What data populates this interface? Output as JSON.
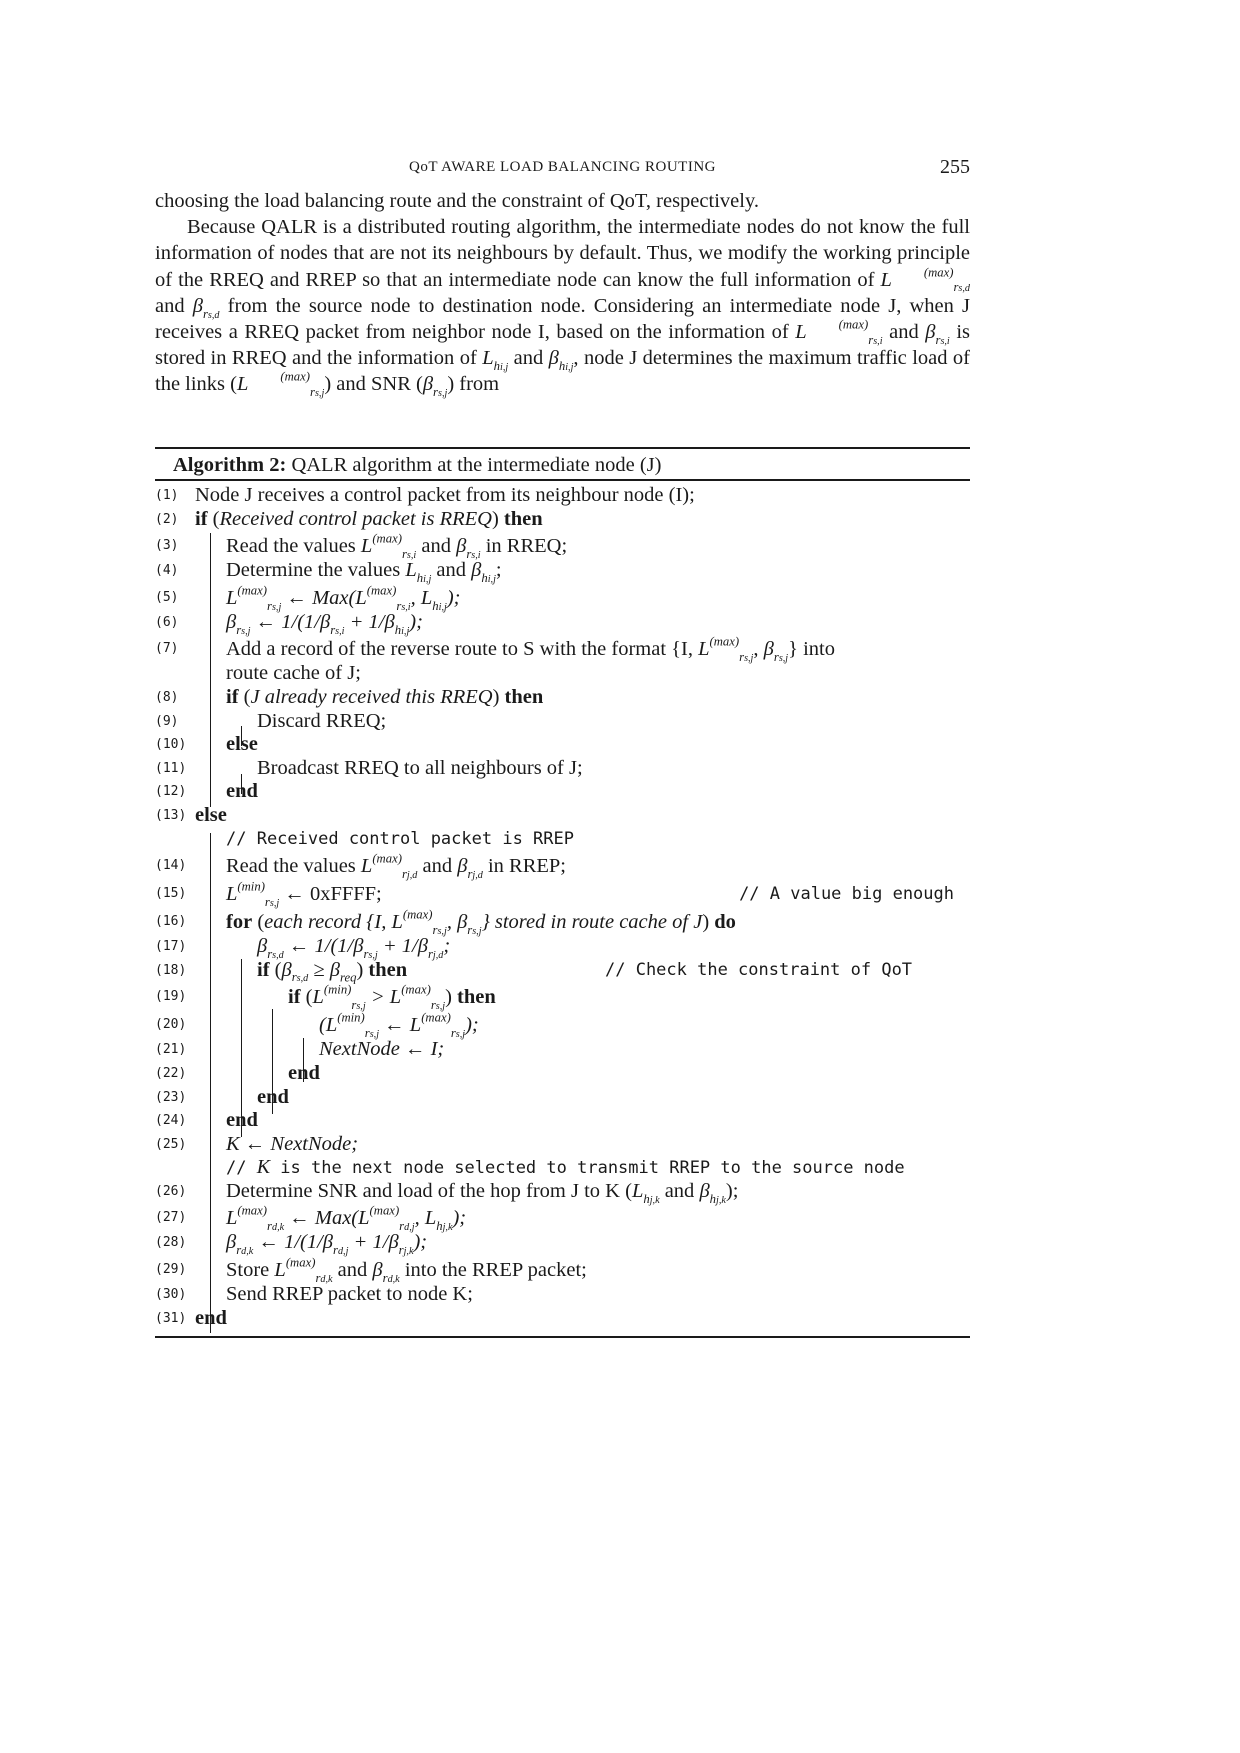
{
  "header": {
    "running_title": "QoT AWARE LOAD BALANCING ROUTING",
    "page_number": "255"
  },
  "body": {
    "p1": "choosing the load balancing route and the constraint of QoT, respectively.",
    "p2_a": "Because QALR is a distributed routing algorithm, the intermediate nodes do not know the full information of nodes that are not its neighbours by default. Thus, we modify the working principle of the RREQ and RREP so that an intermediate node can know the full information of ",
    "p2_b": " and ",
    "p2_c": " from the source node to destination node. Considering an intermediate node J, when J receives a RREQ packet from neighbor node I, based on the information of ",
    "p2_d": " and ",
    "p2_e": " is stored in RREQ and the information of ",
    "p2_f": " and ",
    "p2_g": ", node J determines the maximum traffic load of the links (",
    "p2_h": ") and SNR (",
    "p2_i": ") from"
  },
  "algorithm": {
    "label": "Algorithm 2:",
    "title": "QALR algorithm at the intermediate node (J)",
    "lines": {
      "l1": {
        "no": "(1)",
        "text": "Node J receives a control packet from its neighbour node (I);"
      },
      "l2": {
        "no": "(2)",
        "kw1": "if",
        "cond": "Received control packet is RREQ",
        "kw2": "then"
      },
      "l3": {
        "no": "(3)",
        "a": "Read the values ",
        "b": " and ",
        "c": " in RREQ;"
      },
      "l4": {
        "no": "(4)",
        "a": "Determine the values ",
        "b": " and ",
        "c": ";"
      },
      "l5": {
        "no": "(5)",
        "a": " ← Max(",
        "b": ", ",
        "c": ");"
      },
      "l6": {
        "no": "(6)",
        "a": " ← 1/(1/",
        "b": " + 1/",
        "c": ");"
      },
      "l7": {
        "no": "(7)",
        "a": "Add a record of the reverse route to S with the format {I, ",
        "b": ", ",
        "c": "} into"
      },
      "l7b": {
        "text": "route cache of J;"
      },
      "l8": {
        "no": "(8)",
        "kw1": "if",
        "cond": "J already received this RREQ",
        "kw2": "then"
      },
      "l9": {
        "no": "(9)",
        "text": "Discard RREQ;"
      },
      "l10": {
        "no": "(10)",
        "kw": "else"
      },
      "l11": {
        "no": "(11)",
        "text": "Broadcast RREQ to all neighbours of J;"
      },
      "l12": {
        "no": "(12)",
        "kw": "end"
      },
      "l13": {
        "no": "(13)",
        "kw": "else"
      },
      "c1": {
        "text": "// Received control packet is RREP"
      },
      "l14": {
        "no": "(14)",
        "a": "Read the values ",
        "b": " and ",
        "c": " in RREP;"
      },
      "l15": {
        "no": "(15)",
        "a": " ← 0xFFFF;",
        "comment": "// A value big enough"
      },
      "l16": {
        "no": "(16)",
        "kw1": "for",
        "a": "each record {I, ",
        "b": ", ",
        "c": "} stored in route cache of J",
        "kw2": "do"
      },
      "l17": {
        "no": "(17)",
        "a": " ← 1/(1/",
        "b": " + 1/",
        "c": ";"
      },
      "l18": {
        "no": "(18)",
        "kw1": "if",
        "a": " ≥ ",
        "kw2": "then",
        "comment": "// Check the constraint of QoT"
      },
      "l19": {
        "no": "(19)",
        "kw1": "if",
        "a": " > ",
        "kw2": "then"
      },
      "l20": {
        "no": "(20)",
        "a": " ← ",
        "b": ");"
      },
      "l21": {
        "no": "(21)",
        "text": "NextNode ← I;"
      },
      "l22": {
        "no": "(22)",
        "kw": "end"
      },
      "l23": {
        "no": "(23)",
        "kw": "end"
      },
      "l24": {
        "no": "(24)",
        "kw": "end"
      },
      "l25": {
        "no": "(25)",
        "text": "K ← NextNode;"
      },
      "c2": {
        "a": "// ",
        "k": "K",
        "b": " is the next node selected to transmit RREP to the source node"
      },
      "l26": {
        "no": "(26)",
        "a": "Determine SNR and load of the hop from J to K (",
        "b": " and ",
        "c": ");"
      },
      "l27": {
        "no": "(27)",
        "a": " ← Max(",
        "b": ", ",
        "c": ");"
      },
      "l28": {
        "no": "(28)",
        "a": " ← 1/(1/",
        "b": " + 1/",
        "c": ");"
      },
      "l29": {
        "no": "(29)",
        "a": "Store ",
        "b": " and ",
        "c": " into the RREP packet;"
      },
      "l30": {
        "no": "(30)",
        "text": "Send RREP packet to node K;"
      },
      "l31": {
        "no": "(31)",
        "kw": "end"
      }
    }
  },
  "symbols": {
    "L": "L",
    "beta": "β",
    "max": "(max)",
    "min": "(min)",
    "rsd": "r",
    "rsd_sub": "s,d",
    "rsi_sub": "s,i",
    "rsj_sub": "s,j",
    "rjd_sub": "j,d",
    "rdk_sub": "d,k",
    "rdj_sub": "d,j",
    "rjk_sub": "j,k",
    "h": "h",
    "hij_sub": "i,j",
    "hjk_sub": "j,k",
    "req": "req",
    "lparen": "("
  }
}
